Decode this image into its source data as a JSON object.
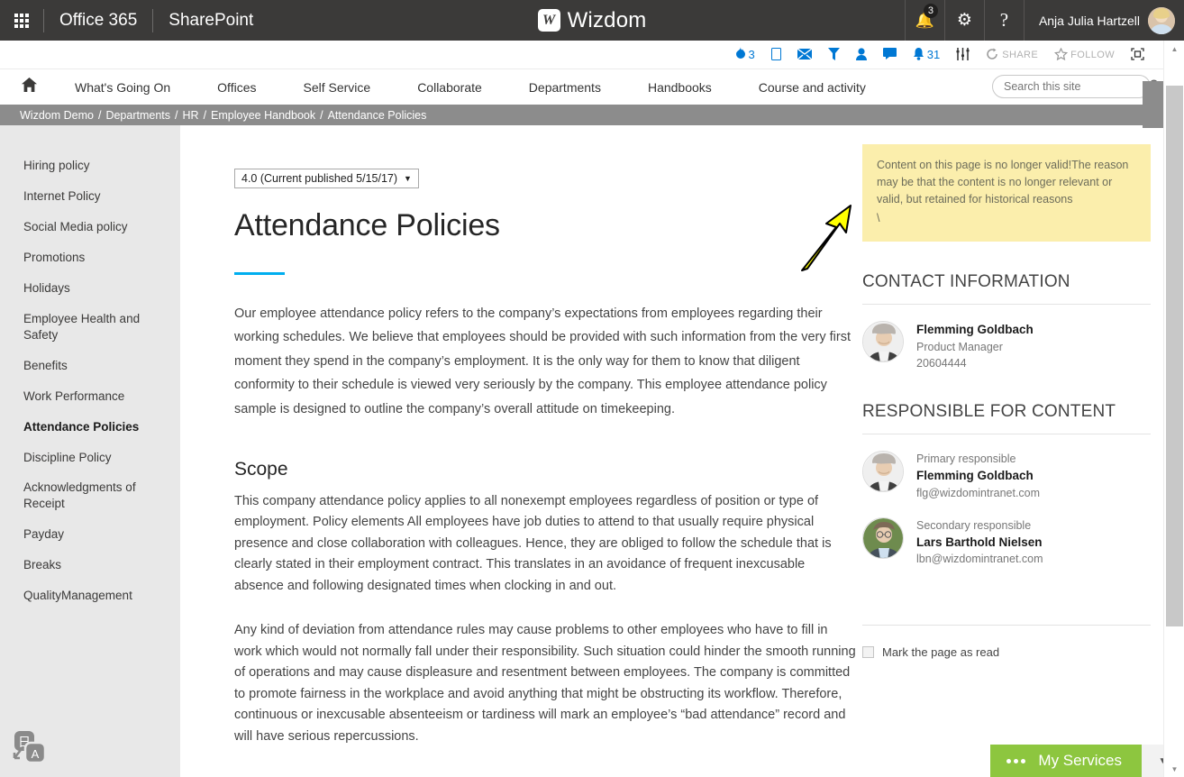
{
  "suite": {
    "waffle_label": "app-launcher",
    "office_label": "Office 365",
    "sharepoint_label": "SharePoint",
    "brand_mark": "W",
    "brand_text": "Wizdom",
    "notification_count": "3",
    "bell_icon": "bell-icon",
    "gear_icon": "gear-icon",
    "help_icon": "help-icon",
    "user_name": "Anja Julia Hartzell"
  },
  "command_bar": {
    "items": [
      {
        "icon": "flame-icon",
        "glyph": "෴",
        "value": "3",
        "label": ""
      },
      {
        "icon": "page-icon",
        "glyph": "▭",
        "value": "",
        "label": ""
      },
      {
        "icon": "mail-icon",
        "glyph": "✉",
        "value": "",
        "label": ""
      },
      {
        "icon": "filter-icon",
        "glyph": "▼",
        "value": "",
        "label": ""
      },
      {
        "icon": "person-icon",
        "glyph": "♟",
        "value": "",
        "label": ""
      },
      {
        "icon": "comment-icon",
        "glyph": "▬",
        "value": "",
        "label": ""
      },
      {
        "icon": "alert-bell-icon",
        "glyph": "▲",
        "value": "31",
        "label": ""
      },
      {
        "icon": "settings-sliders-icon",
        "glyph": "⫼",
        "value": "",
        "label": ""
      }
    ],
    "share_label": "SHARE",
    "share_icon": "share-icon",
    "follow_label": "FOLLOW",
    "follow_icon": "star-icon",
    "focus_icon": "focus-on-content-icon",
    "accent_color": "#0078d4"
  },
  "global_nav": {
    "home_icon": "home-icon",
    "links": [
      "What's Going On",
      "Offices",
      "Self Service",
      "Collaborate",
      "Departments",
      "Handbooks",
      "Course and activity"
    ],
    "search_placeholder": "Search this site",
    "search_value": "",
    "search_icon": "search-icon"
  },
  "breadcrumb": {
    "separator": "/",
    "items": [
      "Wizdom Demo",
      "Departments",
      "HR",
      "Employee Handbook",
      "Attendance Policies"
    ]
  },
  "sidebar": {
    "items": [
      {
        "label": "Hiring policy",
        "active": false
      },
      {
        "label": "Internet Policy",
        "active": false
      },
      {
        "label": "Social Media policy",
        "active": false
      },
      {
        "label": "Promotions",
        "active": false
      },
      {
        "label": "Holidays",
        "active": false
      },
      {
        "label": "Employee Health and Safety",
        "active": false
      },
      {
        "label": "Benefits",
        "active": false
      },
      {
        "label": "Work Performance",
        "active": false
      },
      {
        "label": "Attendance Policies",
        "active": true
      },
      {
        "label": "Discipline Policy",
        "active": false
      },
      {
        "label": "Acknowledgments of Receipt",
        "active": false
      },
      {
        "label": "Payday",
        "active": false
      },
      {
        "label": "Breaks",
        "active": false
      },
      {
        "label": "QualityManagement",
        "active": false
      }
    ]
  },
  "main": {
    "version_select": "4.0 (Current published 5/15/17)",
    "version_caret": "▼",
    "title": "Attendance Policies",
    "accent_rule_color": "#00aeef",
    "paragraph1": "Our employee attendance policy refers to the company’s expectations from employees regarding their working schedules. We believe that employees should be provided with such information from the very first moment they spend in the company’s employment. It is the only way for them to know that diligent conformity to their schedule is viewed very seriously by the company. This employee attendance policy sample is designed to outline the company’s overall attitude on timekeeping.",
    "section_heading": "Scope",
    "paragraph2": "This company attendance policy applies to all nonexempt employees regardless of position or type of employment. Policy elements All employees have job duties to attend to that usually require physical presence and close collaboration with colleagues. Hence, they are obliged to follow the schedule that is clearly stated in their employment contract. This translates in an avoidance of frequent inexcusable absence and following designated times when clocking in and out.",
    "paragraph3": "Any kind of deviation from attendance rules may cause problems to other employees who have to fill in work which would not normally fall under their responsibility. Such situation could hinder the smooth running of operations and may cause displeasure and resentment between employees. The company is committed to promote fairness in the workplace and avoid anything that might be obstructing its workflow. Therefore, continuous or inexcusable absenteeism or tardiness will mark an employee’s “bad attendance” record and will have serious repercussions."
  },
  "rail": {
    "notice_text": "Content on this page is no longer valid!The reason may be that the content is no longer relevant or valid, but retained for historical reasons",
    "notice_trailing": "\\",
    "notice_bg": "#fbeeac",
    "contact_heading": "CONTACT INFORMATION",
    "contact": {
      "avatar": "person-photo-flemming",
      "name": "Flemming Goldbach",
      "role": "Product Manager",
      "phone": "20604444"
    },
    "responsible_heading": "RESPONSIBLE FOR CONTENT",
    "responsible": [
      {
        "avatar": "person-photo-flemming",
        "kicker": "Primary responsible",
        "name": "Flemming Goldbach",
        "email": "flg@wizdomintranet.com"
      },
      {
        "avatar": "person-photo-lars",
        "kicker": "Secondary responsible",
        "name": "Lars Barthold Nielsen",
        "email": "lbn@wizdomintranet.com"
      }
    ],
    "mark_read_label": "Mark the page as read",
    "mark_read_checked": false
  },
  "widgets": {
    "translate_icon": "translate-icon",
    "my_services_label": "My Services",
    "my_services_color": "#8dc63f",
    "my_services_dots_icon": "ellipsis-icon",
    "my_services_caret": "▼"
  },
  "scrollbar": {
    "up_arrow": "▲",
    "down_arrow": "▼"
  }
}
